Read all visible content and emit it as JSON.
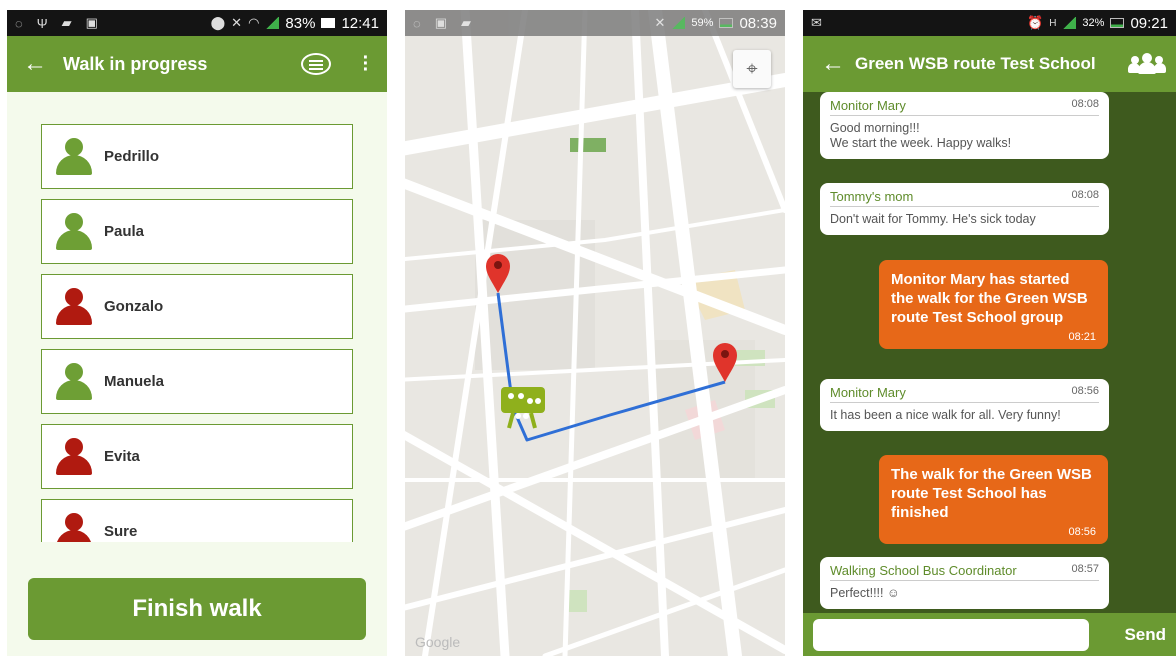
{
  "screen1": {
    "status": {
      "battery": "83%",
      "time": "12:41"
    },
    "title": "Walk in progress",
    "children": [
      {
        "name": "Pedrillo",
        "status": "green"
      },
      {
        "name": "Paula",
        "status": "green"
      },
      {
        "name": "Gonzalo",
        "status": "red"
      },
      {
        "name": "Manuela",
        "status": "green"
      },
      {
        "name": "Evita",
        "status": "red"
      },
      {
        "name": "Sure",
        "status": "red"
      }
    ],
    "finish_label": "Finish walk"
  },
  "screen2": {
    "status": {
      "battery": "59%",
      "time": "08:39"
    },
    "map_watermark": "Google"
  },
  "screen3": {
    "status": {
      "battery": "32%",
      "time": "09:21"
    },
    "title": "Green WSB route Test School",
    "messages": [
      {
        "type": "in",
        "sender": "Monitor Mary",
        "time": "08:08",
        "text": "Good morning!!!\nWe start the week. Happy walks!"
      },
      {
        "type": "in",
        "sender": "Tommy's mom",
        "time": "08:08",
        "text": "Don't wait for Tommy. He's sick today"
      },
      {
        "type": "out",
        "time": "08:21",
        "text": "Monitor Mary has started the walk for the Green WSB route Test School group"
      },
      {
        "type": "in",
        "sender": "Monitor Mary",
        "time": "08:56",
        "text": "It has been a nice walk for all. Very funny!"
      },
      {
        "type": "out",
        "time": "08:56",
        "text": "The walk for the Green WSB route Test School has finished"
      },
      {
        "type": "in",
        "sender": "Walking School Bus Coordinator",
        "time": "08:57",
        "text": "Perfect!!!! ☺"
      }
    ],
    "input_placeholder": "",
    "send_label": "Send"
  },
  "colors": {
    "green": "#6b9a33",
    "dark_green": "#3e5a1e",
    "orange": "#e76818",
    "red": "#b01a10",
    "route": "#2f6fd6",
    "pin": "#e0342b"
  },
  "icons": [
    "back-arrow-icon",
    "chat-icon",
    "more-vert-icon",
    "person-icon",
    "my-location-icon",
    "map-pin-icon",
    "walking-bus-icon",
    "group-icon"
  ]
}
